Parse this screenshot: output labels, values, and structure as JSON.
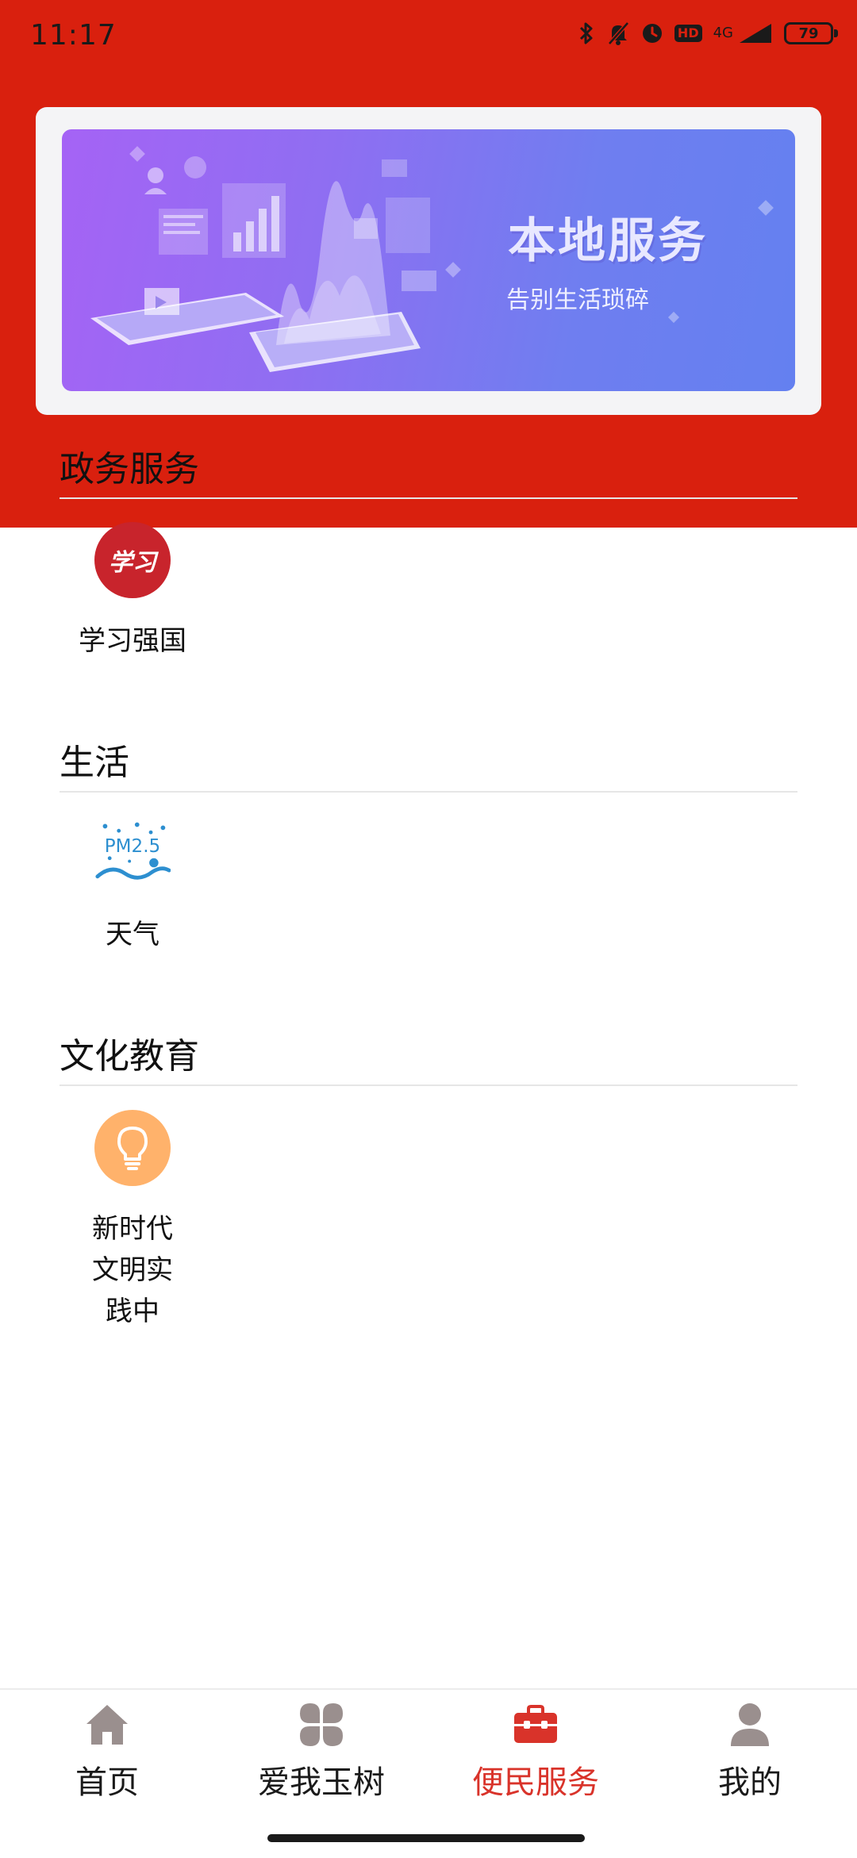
{
  "status_bar": {
    "time": "11:17",
    "hd": "HD",
    "network": "4G",
    "battery": "79"
  },
  "banner": {
    "title": "本地服务",
    "subtitle": "告别生活琐碎"
  },
  "sections": [
    {
      "title": "政务服务",
      "apps": [
        {
          "label": "学习强国",
          "icon": "xuexi-qiangguo-icon",
          "icon_glyph": "学习"
        }
      ]
    },
    {
      "title": "生活",
      "apps": [
        {
          "label": "天气",
          "icon": "pm25-weather-icon",
          "icon_glyph": "PM2.5"
        }
      ]
    },
    {
      "title": "文化教育",
      "apps": [
        {
          "label": "新时代文明实践中",
          "icon": "lightbulb-icon"
        }
      ]
    }
  ],
  "bottom_nav": {
    "items": [
      {
        "label": "首页",
        "icon": "home-icon",
        "active": false
      },
      {
        "label": "爱我玉树",
        "icon": "clover-icon",
        "active": false
      },
      {
        "label": "便民服务",
        "icon": "toolbox-icon",
        "active": true
      },
      {
        "label": "我的",
        "icon": "person-icon",
        "active": false
      }
    ]
  },
  "colors": {
    "brand_red": "#D9200E",
    "active_nav": "#D9332A",
    "banner_gradient_start": "#A563F5",
    "banner_gradient_end": "#6480F0",
    "xuexi_red": "#C8242C",
    "bulb_orange": "#FFB26B",
    "pm25_blue": "#2D8FD0"
  }
}
